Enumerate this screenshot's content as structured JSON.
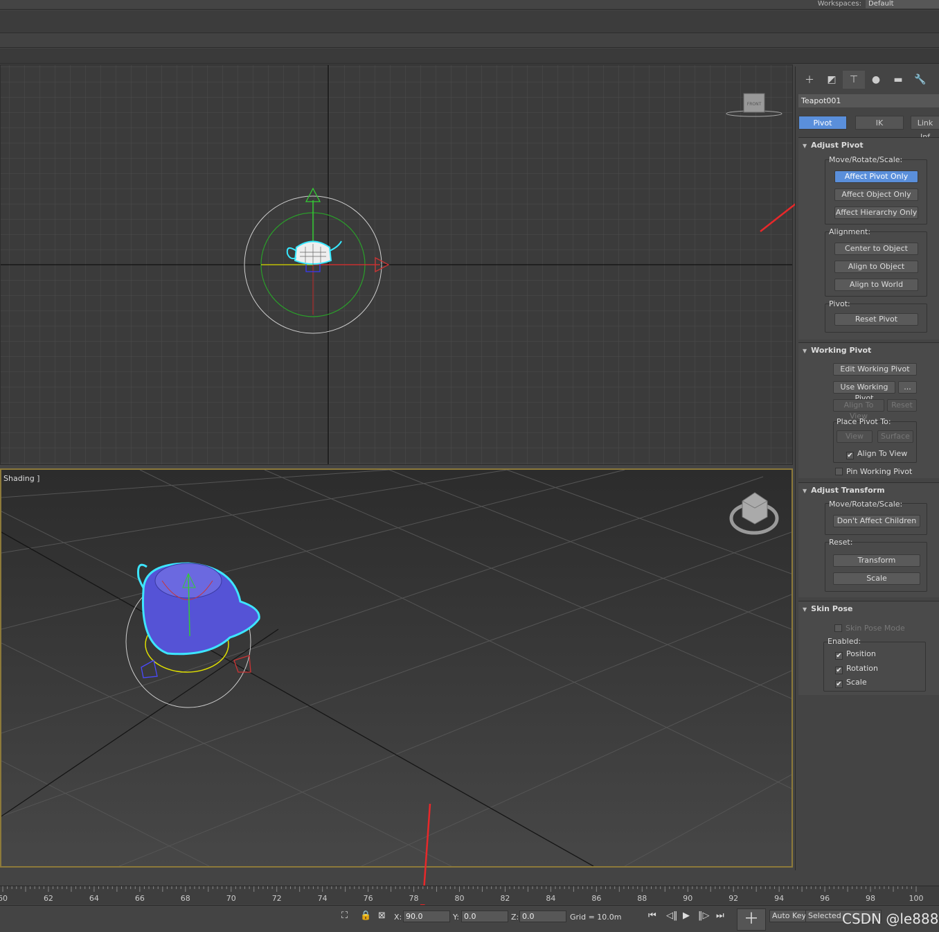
{
  "workspace": {
    "label": "Workspaces:",
    "value": "Default"
  },
  "viewports": {
    "perspective_label": "Shading ]",
    "front_cube_label": "FRONT"
  },
  "command_panel": {
    "tabs": [
      "create-icon",
      "modify-icon",
      "hierarchy-icon",
      "motion-icon",
      "display-icon",
      "utilities-icon"
    ],
    "object_name": "Teapot001",
    "subtabs": [
      "Pivot",
      "IK",
      "Link Inf"
    ],
    "adjust_pivot": {
      "title": "Adjust Pivot",
      "move_label": "Move/Rotate/Scale:",
      "affect_pivot": "Affect Pivot Only",
      "affect_object": "Affect Object Only",
      "affect_hierarchy": "Affect Hierarchy Only",
      "alignment_label": "Alignment:",
      "center_to_object": "Center to Object",
      "align_to_object": "Align to Object",
      "align_to_world": "Align to World",
      "pivot_label": "Pivot:",
      "reset_pivot": "Reset Pivot"
    },
    "working_pivot": {
      "title": "Working Pivot",
      "edit": "Edit Working Pivot",
      "use": "Use Working Pivot",
      "more": "...",
      "align_to_view": "Align To View",
      "reset": "Reset",
      "place_label": "Place Pivot To:",
      "view": "View",
      "surface": "Surface",
      "align_to_view_chk": "Align To View",
      "pin": "Pin Working Pivot"
    },
    "adjust_transform": {
      "title": "Adjust Transform",
      "move_label": "Move/Rotate/Scale:",
      "dont_affect": "Don't Affect Children",
      "reset_label": "Reset:",
      "transform": "Transform",
      "scale": "Scale"
    },
    "skin_pose": {
      "title": "Skin Pose",
      "mode": "Skin Pose Mode",
      "enabled_label": "Enabled:",
      "position": "Position",
      "rotation": "Rotation",
      "scale": "Scale",
      "check": "✔"
    }
  },
  "timeline": {
    "ticks": [
      "60",
      "62",
      "64",
      "66",
      "68",
      "70",
      "72",
      "74",
      "76",
      "78",
      "80",
      "82",
      "84",
      "86",
      "88",
      "90",
      "92",
      "94",
      "96",
      "98",
      "100"
    ]
  },
  "status": {
    "x_label": "X:",
    "x_value": "90.0",
    "y_label": "Y:",
    "y_value": "0.0",
    "z_label": "Z:",
    "z_value": "0.0",
    "grid": "Grid = 10.0m",
    "auto_key": "Auto Key",
    "selected": "Selected",
    "watermark": "CSDN @le888"
  },
  "colors": {
    "accent": "#5a8fdb",
    "viewport_border": "#8d7a3a",
    "annotation_arrow": "#e8282a"
  }
}
